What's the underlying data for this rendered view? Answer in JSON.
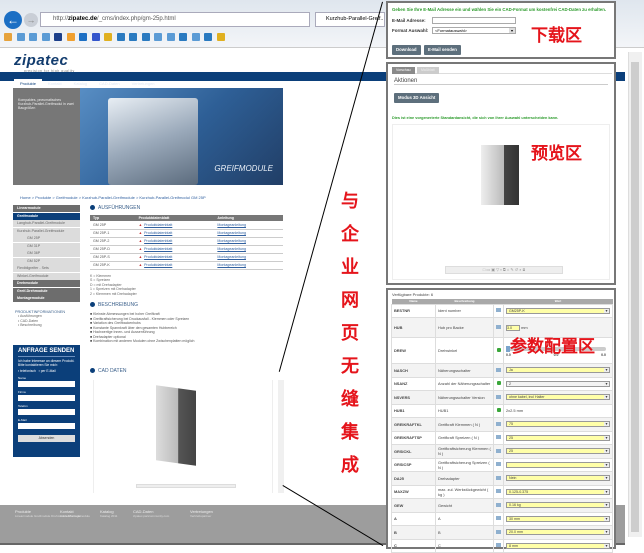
{
  "browser": {
    "back": "←",
    "url_pre": "http://",
    "url_host": "zipatec.de",
    "url_path": "/_cms/index.php/gm-25p.html",
    "tab": "Kurzhub-Parallel-Greif..."
  },
  "site": {
    "logo": "zipatec",
    "slogan": "precision for high quality",
    "nav": [
      "Produkte",
      "Kontakt",
      "Katalog",
      "CAD-Daten",
      "Vertretungen"
    ],
    "hero": {
      "side_text": "Kompaktes, pneumatisches Kurzhub-Parallel-Greifmodul in zwei Baugrößen",
      "caption": "GREIFMODULE"
    },
    "breadcrumb": "Home > Produkte > Greifmodule > Kurzhub-Parallel-Greifmodule > Kurzhub-Parallel-Greifmodul GM 25P",
    "sidebar": [
      {
        "label": "Linearmodule",
        "style": "dark"
      },
      {
        "label": "Greifmodule",
        "style": "blue"
      },
      {
        "label": "Langhub-Parallel-Greifmodule",
        "style": "light"
      },
      {
        "label": "Kurzhub-Parallel-Greifmodule",
        "style": "light"
      },
      {
        "label": "GM 25P",
        "style": "light"
      },
      {
        "label": "GM 31P",
        "style": "light"
      },
      {
        "label": "GM 36P",
        "style": "light"
      },
      {
        "label": "GM 52P",
        "style": "light"
      },
      {
        "label": "Flexibilgreifer - Sets",
        "style": "light"
      },
      {
        "label": "Winkel-Greifmodule",
        "style": "light"
      },
      {
        "label": "Drehmodule",
        "style": "dark"
      },
      {
        "label": "Greif-Drehmodule",
        "style": "dark"
      },
      {
        "label": "Montagemodule",
        "style": "dark"
      }
    ],
    "prodinfo": {
      "title": "PRODUKTINFORMATIONEN",
      "items": [
        "Ausführungen",
        "CAD-Daten",
        "Beschreibung"
      ]
    },
    "ausf": {
      "title": "AUSFÜHRUNGEN",
      "headers": [
        "Typ",
        "Produktdatenblatt",
        "Anleitung"
      ],
      "rows": [
        [
          "GM 25P",
          "Produktdatenblatt",
          "Montageanleitung"
        ],
        [
          "GM 25P-1",
          "Produktdatenblatt",
          "Montageanleitung"
        ],
        [
          "GM 25P-2",
          "Produktdatenblatt",
          "Montageanleitung"
        ],
        [
          "GM 25P-D",
          "Produktdatenblatt",
          "Montageanleitung"
        ],
        [
          "GM 25P-S",
          "Produktdatenblatt",
          "Montageanleitung"
        ],
        [
          "GM 25P-K",
          "Produktdatenblatt",
          "Montageanleitung"
        ]
      ],
      "legend": [
        "K = Klemmen",
        "S = Spreizen",
        "D = mit Drehadapter",
        "1 = Spreizen mit Drehadapter",
        "2 = Klemmen mit Drehadapter"
      ]
    },
    "beschreibung": {
      "title": "BESCHREIBUNG",
      "items": [
        "Kleinste Abmessungen bei hoher Greifkraft",
        "Greifkraftsicherung bei Druckausfall - Klemmen oder Spreizen",
        "Variation des Greifbackenhubs",
        "Konstante Spannkraft über den gesamten Hubbereich",
        "Hochwertige Innen- und Aussenführung",
        "Drehadapter optional",
        "Kombination mit anderen Modulen ohne Zwischenplatten möglich"
      ]
    },
    "form": {
      "title": "ANFRAGE SENDEN",
      "subtitle": "Ich habe Interesse an diesem Produkt. Bitte kontaktieren Sie mich:",
      "opt1": "telefonisch",
      "opt2": "per E-Mail",
      "fields": [
        "Name",
        "Firma",
        "Telefon",
        "E-Mail"
      ],
      "submit": "Absenden"
    },
    "cad": {
      "title": "CAD DATEN"
    },
    "footer": [
      {
        "h": "Produkte",
        "s": "Linearmodule Greifmodule Drehmodule Montagemodule"
      },
      {
        "h": "Kontakt",
        "s": "Kontaktformular"
      },
      {
        "h": "Katalog",
        "s": "Katalog 2011"
      },
      {
        "h": "CAD-Daten",
        "s": "zipatec.partcommunity.com"
      },
      {
        "h": "Vertretungen",
        "s": "Vertriebspartner"
      }
    ]
  },
  "download": {
    "intro": "Geben Sie Ihre E-Mail Adresse ein und wählen Sie ein CAD-Format um kostenfrei CAD-Daten zu erhalten.",
    "email_label": "E-Mail Adresse:",
    "email_value": "",
    "format_label": "Format Auswahl:",
    "format_value": "<Formatauswahl>",
    "download_btn": "Download",
    "email_btn": "E-Mail senden",
    "annotation": "下载区"
  },
  "preview": {
    "tabs": [
      "Vorschau",
      "Maßblatt"
    ],
    "section": "Aktionen",
    "mode_btn": "Modus 3D Ansicht",
    "note": "Dies ist eine vorgenerierte Standardansicht, die sich von Ihrer Auswahl unterscheiden kann.",
    "annotation": "预览区"
  },
  "params": {
    "available": "Verfügbare Produkte: 6",
    "headers": [
      "Name",
      "Beschreibung",
      "",
      "Wert"
    ],
    "annotation": "参数配置区",
    "rows": [
      {
        "name": "BESTNR",
        "desc": "Ident number",
        "icon": "table",
        "value": "GM25P-K",
        "kind": "select"
      },
      {
        "name": "HUB",
        "desc": "Hub pro Backe",
        "icon": "table",
        "value": "3.0",
        "unit": "mm",
        "kind": "input"
      },
      {
        "name": "DREW",
        "desc": "Drehwinkel",
        "icon": "lock",
        "kind": "slider",
        "slider": [
          "0.0",
          "0.0",
          "0.0"
        ]
      },
      {
        "name": "NASCH",
        "desc": "Näherungsschalter",
        "icon": "table",
        "value": "Ja",
        "kind": "select"
      },
      {
        "name": "NSANZ",
        "desc": "Anzahl der Näherungsschalter",
        "icon": "lock",
        "value": "2",
        "kind": "select-gray"
      },
      {
        "name": "NSVERS",
        "desc": "Näherungsschalter Version",
        "icon": "table",
        "value": "ohne kabel, incl Halter",
        "kind": "select"
      },
      {
        "name": "HUB1",
        "desc": "HUB1",
        "icon": "lock",
        "value": "2x2.5 mm",
        "kind": "text"
      },
      {
        "name": "GREIKRAFTKL",
        "desc": "Greifkraft Klemmen ( N )",
        "icon": "table",
        "value": "75",
        "kind": "select"
      },
      {
        "name": "GREIKRAFTSP",
        "desc": "Greifkraft Spreizen ( N )",
        "icon": "table",
        "value": "25",
        "kind": "select"
      },
      {
        "name": "GRSICKL",
        "desc": "Greifkraftsicherung Klemmen ( N )",
        "icon": "table",
        "value": "25",
        "kind": "select"
      },
      {
        "name": "GRSICSP",
        "desc": "Greifkraftsicherung Spreizen ( N )",
        "icon": "table",
        "value": "",
        "kind": "select"
      },
      {
        "name": "DA25",
        "desc": "Drehadapter",
        "icon": "table",
        "value": "Nein",
        "kind": "select"
      },
      {
        "name": "MAXZW",
        "desc": "max. zul. Werkstückgewicht ( kg )",
        "icon": "table",
        "value": "0.125-0.375",
        "kind": "select"
      },
      {
        "name": "GEW",
        "desc": "Gewicht",
        "icon": "table",
        "value": "0.16 kg",
        "kind": "select"
      },
      {
        "name": "A",
        "desc": "A",
        "icon": "table",
        "value": "30 mm",
        "kind": "select"
      },
      {
        "name": "B",
        "desc": "B",
        "icon": "table",
        "value": "20.0 mm",
        "kind": "select"
      },
      {
        "name": "C",
        "desc": "C",
        "icon": "table",
        "value": "8 mm",
        "kind": "select"
      }
    ]
  },
  "annotation_vertical": [
    "与",
    "企",
    "业",
    "网",
    "页",
    "无",
    "缝",
    "集",
    "成"
  ],
  "colors": {
    "brand": "#0b3f7a",
    "annotation": "#e5141b",
    "hint_green": "#2a9a2a",
    "select_bg": "#ffffa8"
  }
}
